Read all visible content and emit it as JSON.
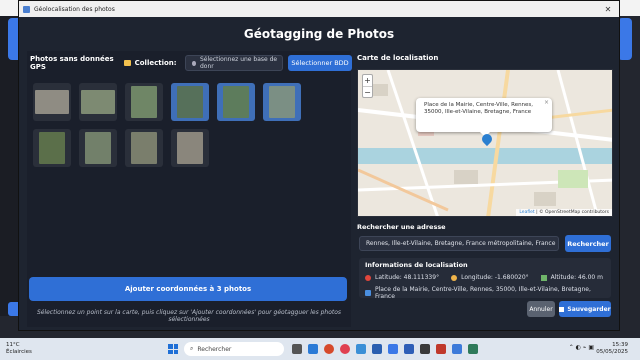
{
  "window": {
    "title": "Géolocalisation des photos",
    "heading": "Géotagging de Photos"
  },
  "left": {
    "photos_label": "Photos sans données GPS",
    "collection_label": "Collection:",
    "db_placeholder": "Sélectionnez une base de donr",
    "select_db_button": "Sélectionner BDD",
    "add_button": "Ajouter coordonnées à 3 photos",
    "hint": "Sélectionnez un point sur la carte, puis cliquez sur 'Ajouter coordonnées' pour géotagguer les photos sélectionnées",
    "photos": [
      {
        "selected": false,
        "color": "#8f8c83",
        "landscape": true
      },
      {
        "selected": false,
        "color": "#7d8a72",
        "landscape": true
      },
      {
        "selected": false,
        "color": "#6f8666",
        "landscape": false
      },
      {
        "selected": true,
        "color": "#56705a",
        "landscape": false
      },
      {
        "selected": true,
        "color": "#5d7c5c",
        "landscape": false
      },
      {
        "selected": true,
        "color": "#7b8f84",
        "landscape": false
      },
      {
        "selected": false,
        "color": "#5b6f4a",
        "landscape": false
      },
      {
        "selected": false,
        "color": "#72806a",
        "landscape": false
      },
      {
        "selected": false,
        "color": "#7a7e6c",
        "landscape": false
      },
      {
        "selected": false,
        "color": "#8a867c",
        "landscape": false
      }
    ]
  },
  "right": {
    "map_title": "Carte de localisation",
    "popup_text": "Place de la Mairie, Centre-Ville, Rennes, 35000, Ille-et-Vilaine, Bretagne, France",
    "popup_close": "×",
    "zoom_in": "+",
    "zoom_out": "−",
    "attribution_prefix": "Leaflet",
    "attribution_rest": " | © OpenStreetMap contributors",
    "search_label": "Rechercher une adresse",
    "search_value": "Rennes, Ille-et-Vilaine, Bretagne, France métropolitaine, France",
    "search_button": "Rechercher",
    "info_title": "Informations de localisation",
    "latitude": "Latitude: 48.111339°",
    "longitude": "Longitude: -1.680020°",
    "altitude": "Altitude: 46.00 m",
    "address": "Place de la Mairie, Centre-Ville, Rennes, 35000, Ille-et-Vilaine, Bretagne, France",
    "cancel_button": "Annuler",
    "save_button": "Sauvegarder"
  },
  "taskbar": {
    "temperature": "11°C",
    "weather": "Éclaircies",
    "search": "Rechercher",
    "time": "15:39",
    "date": "05/05/2025"
  },
  "colors": {
    "accent": "#2f6fd6",
    "dialog_bg": "#1e2430",
    "panel_bg": "#1a1f2b"
  }
}
